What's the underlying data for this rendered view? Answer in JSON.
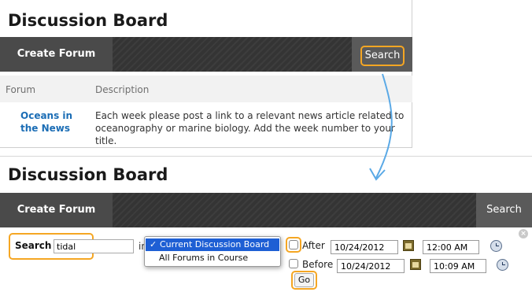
{
  "top_panel": {
    "title": "Discussion Board",
    "toolbar": {
      "create_forum": "Create Forum",
      "search": "Search"
    },
    "table": {
      "headers": [
        "Forum",
        "Description"
      ],
      "rows": [
        {
          "forum": "Oceans in the News",
          "description": "Each week please post a link to a relevant news article related to oceanography or marine biology. Add the week number to your title."
        }
      ]
    }
  },
  "bottom_panel": {
    "title": "Discussion Board",
    "toolbar": {
      "create_forum": "Create Forum",
      "search": "Search"
    },
    "search_form": {
      "label": "Search",
      "query": "tidal",
      "in_label": "in",
      "scope_options": [
        "Current Discussion Board",
        "All Forums in Course"
      ],
      "selected_scope": "Current Discussion Board",
      "after_label": "After",
      "after_date": "10/24/2012",
      "after_time": "12:00 AM",
      "before_label": "Before",
      "before_date": "10/24/2012",
      "before_time": "10:09 AM",
      "go_label": "Go"
    }
  },
  "colors": {
    "highlight": "#f5a623",
    "toolbar": "#343434",
    "link": "#1b6db5",
    "arrow": "#5aa9e6",
    "selection": "#1e5fd4"
  }
}
